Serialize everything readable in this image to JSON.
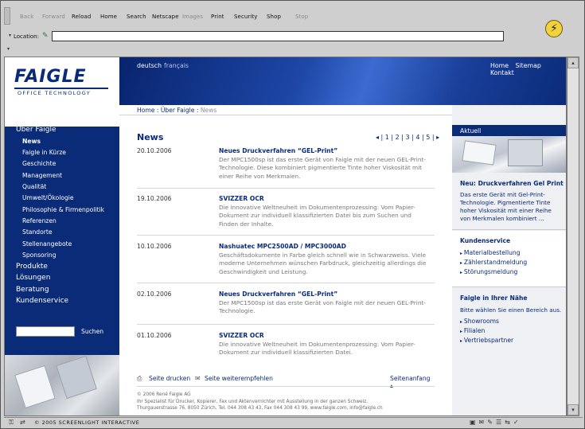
{
  "browser": {
    "toolbar": [
      "Back",
      "Forward",
      "Reload",
      "Home",
      "Search",
      "Netscape",
      "Images",
      "Print",
      "Security",
      "Shop",
      "Stop"
    ],
    "location_label": "Location:",
    "location_value": "",
    "status_text": "© 2005 SCREENLIGHT INTERACTIVE"
  },
  "site": {
    "logo": "FAIGLE",
    "logo_sub": "OFFICE TECHNOLOGY",
    "lang_de": "deutsch",
    "lang_fr": "français",
    "top_links": [
      "Home",
      "Sitemap",
      "Kontakt"
    ],
    "breadcrumb_home": "Home",
    "breadcrumb_sep1": ":",
    "breadcrumb_mid": "Über Faigle",
    "breadcrumb_sep2": ":",
    "breadcrumb_cur": "News"
  },
  "left_nav": {
    "section": "Über Faigle",
    "sub": [
      "News",
      "Faigle in Kürze",
      "Geschichte",
      "Management",
      "Qualität",
      "Umwelt/Ökologie",
      "Philosophie & Firmenpolitik",
      "Referenzen",
      "Standorte",
      "Stellenangebote",
      "Sponsoring"
    ],
    "main": [
      "Produkte",
      "Lösungen",
      "Beratung",
      "Kundenservice"
    ],
    "search_label": "Suchen"
  },
  "news": {
    "title": "News",
    "pager": "◂ | 1 | 2 | 3 | 4 | 5 | ▸",
    "items": [
      {
        "date": "20.10.2006",
        "head": "Neues Druckverfahren “GEL-Print”",
        "body": "Der MPC1500sp ist das erste Gerät von Faigle mit der neuen GEL-Print-Technologie. Diese kombiniert pigmentierte Tinte hoher Viskosität mit einer Reihe von Merkmalen."
      },
      {
        "date": "19.10.2006",
        "head": "SVIZZER OCR",
        "body": "Die innovative Weltneuheit im Dokumentenprozessing: Vom Papier-Dokument zur individuell klassifizierten Datei bis zum Suchen und Finden der Inhalte."
      },
      {
        "date": "10.10.2006",
        "head": "Nashuatec MPC2500AD / MPC3000AD",
        "body": "Geschäftsdokumente in Farbe gleich schnell wie in Schwarzweiss. Viele moderne Unternehmen wünschen Farbdruck, gleichzeitig allerdings die Geschwindigkeit und Leistung."
      },
      {
        "date": "02.10.2006",
        "head": "Neues Druckverfahren “GEL-Print”",
        "body": "Der MPC1500sp ist das erste Gerät von Faigle mit der neuen GEL-Print-Technologie."
      },
      {
        "date": "01.10.2006",
        "head": "SVIZZER OCR",
        "body": "Die innovative Weltneuheit im Dokumentenprozessing: Vom Papier-Dokument zur individuell klassifizierten Datei."
      }
    ],
    "tools_print": "Seite drucken",
    "tools_mail": "Seite weiterempfehlen",
    "tools_top": "Seitenanfang ▴",
    "footer_1": "© 2006 René Faigle AG",
    "footer_2": "Ihr Spezialist für Drucker, Kopierer, Fax und Aktenvernichter mit Ausstellung in der ganzen Schweiz.",
    "footer_3": "Thurgauerstrasse 76, 8050 Zürich, Tel. 044 308 43 43, Fax 044 308 43 99, www.faigle.com, info@faigle.ch"
  },
  "right": {
    "aktuell": "Aktuell",
    "teaser_title": "Neu: Druckverfahren Gel Print",
    "teaser_body": "Das erste Gerät  mit Gel-Print-Technologie. Pigmentierte Tinte hoher Viskosität mit einer Reihe von Merkmalen kombiniert ...",
    "ks_title": "Kundenservice",
    "ks_links": [
      "Materialbestellung",
      "Zählerstandmeldung",
      "Störungsmeldung"
    ],
    "near_title": "Faigle in Ihrer Nähe",
    "near_body": "Bitte wählen Sie einen Bereich aus.",
    "near_links": [
      "Showrooms",
      "Filialen",
      "Vertriebspartner"
    ]
  },
  "colors": {
    "brand_blue": "#0a2b78",
    "header_blue": "#1d46a6"
  }
}
